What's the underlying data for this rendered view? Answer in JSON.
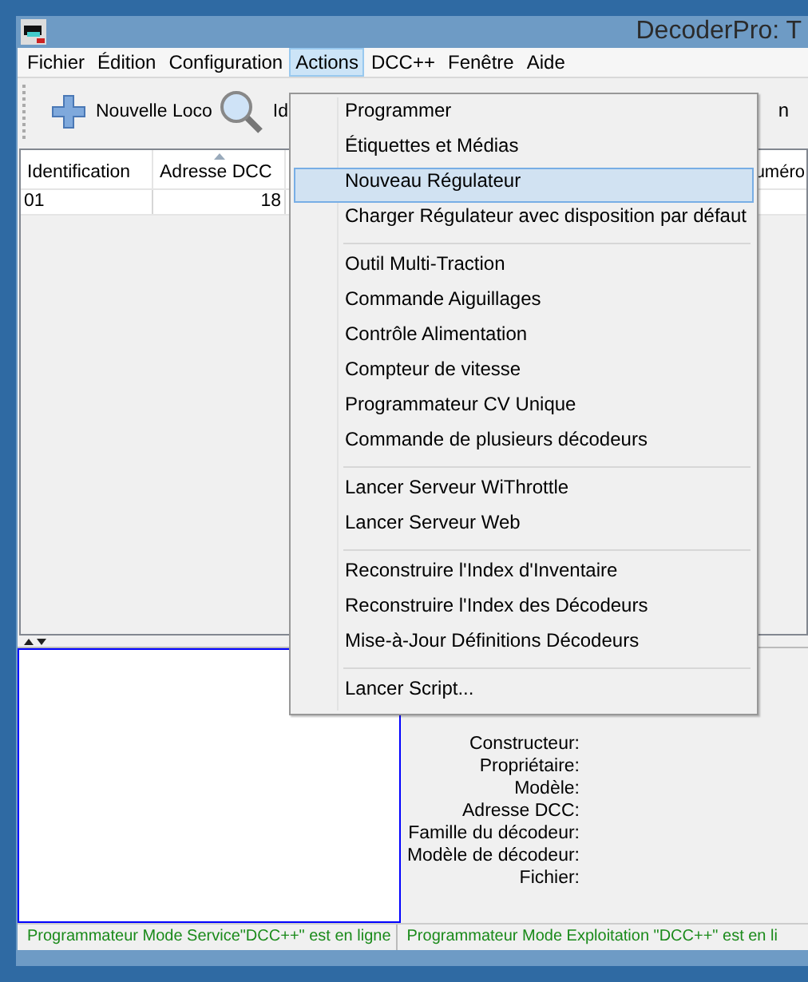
{
  "window": {
    "title": "DecoderPro: T"
  },
  "menu_bar": [
    {
      "label": "Fichier",
      "selected": false
    },
    {
      "label": "Édition",
      "selected": false
    },
    {
      "label": "Configuration",
      "selected": false
    },
    {
      "label": "Actions",
      "selected": true
    },
    {
      "label": "DCC++",
      "selected": false
    },
    {
      "label": "Fenêtre",
      "selected": false
    },
    {
      "label": "Aide",
      "selected": false
    }
  ],
  "toolbar": {
    "buttons": [
      {
        "kind": "add",
        "label": "Nouvelle Loco"
      },
      {
        "kind": "search",
        "label": "Id"
      }
    ],
    "right_text": "n"
  },
  "table": {
    "columns": [
      "Identification",
      "Adresse DCC",
      "uméro"
    ],
    "rows": [
      [
        "01",
        "18"
      ]
    ]
  },
  "details": {
    "labels": [
      "Constructeur:",
      "Propriétaire:",
      "Modèle:",
      "Adresse DCC:",
      "Famille du décodeur:",
      "Modèle de décodeur:",
      "Fichier:"
    ]
  },
  "status_bar": [
    "Programmateur Mode Service\"DCC++\" est en ligne",
    "Programmateur Mode Exploitation \"DCC++\" est en li"
  ],
  "actions_menu": [
    [
      {
        "label": "Programmer",
        "selected": false
      },
      {
        "label": "Étiquettes et Médias",
        "selected": false
      },
      {
        "label": "Nouveau Régulateur",
        "selected": true
      },
      {
        "label": "Charger Régulateur avec disposition par défaut",
        "selected": false
      }
    ],
    [
      {
        "label": "Outil Multi-Traction",
        "selected": false
      },
      {
        "label": "Commande Aiguillages",
        "selected": false
      },
      {
        "label": "Contrôle Alimentation",
        "selected": false
      },
      {
        "label": "Compteur de vitesse",
        "selected": false
      },
      {
        "label": "Programmateur CV Unique",
        "selected": false
      },
      {
        "label": "Commande de plusieurs décodeurs",
        "selected": false
      }
    ],
    [
      {
        "label": "Lancer Serveur WiThrottle",
        "selected": false
      },
      {
        "label": "Lancer Serveur Web",
        "selected": false
      }
    ],
    [
      {
        "label": "Reconstruire l'Index d'Inventaire",
        "selected": false
      },
      {
        "label": "Reconstruire l'Index des Décodeurs",
        "selected": false
      },
      {
        "label": "Mise-à-Jour Définitions Décodeurs",
        "selected": false
      }
    ],
    [
      {
        "label": "Lancer Script...",
        "selected": false
      }
    ]
  ]
}
